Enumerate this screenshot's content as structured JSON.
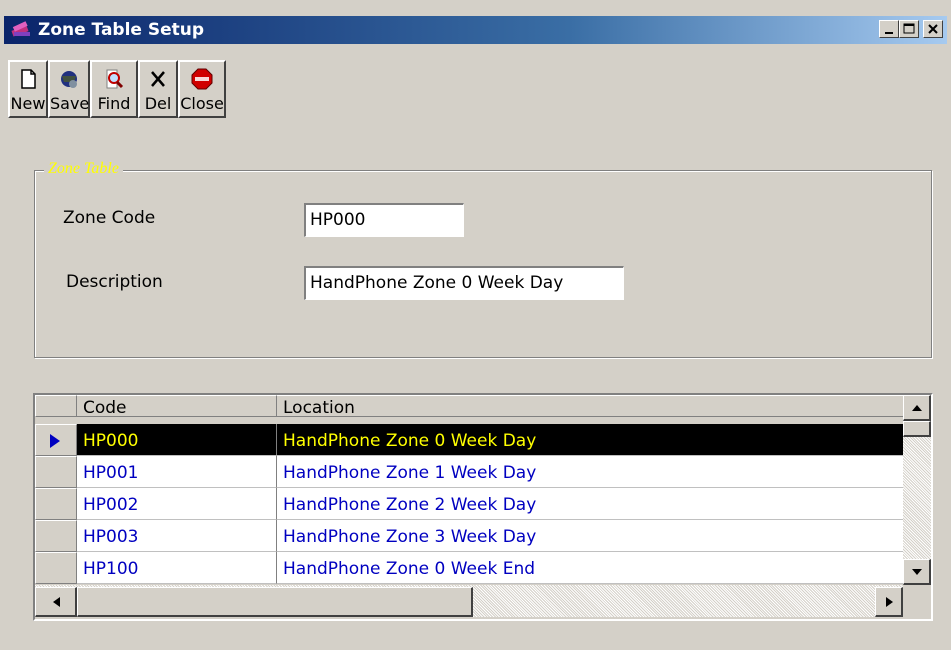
{
  "window": {
    "title": "Zone Table Setup",
    "controls": [
      "minimize",
      "maximize",
      "close"
    ]
  },
  "toolbar": {
    "buttons": [
      {
        "label": "New",
        "icon": "new-document-icon"
      },
      {
        "label": "Save",
        "icon": "save-icon"
      },
      {
        "label": "Find",
        "icon": "find-magnifier-icon"
      },
      {
        "label": "Del",
        "icon": "delete-x-icon"
      },
      {
        "label": "Close",
        "icon": "stop-sign-icon"
      }
    ]
  },
  "form": {
    "group_title": "Zone Table",
    "zone_code_label": "Zone Code",
    "zone_code_value": "HP000",
    "description_label": "Description",
    "description_value": "HandPhone Zone 0 Week Day"
  },
  "grid": {
    "columns": [
      "Code",
      "Location"
    ],
    "rows": [
      {
        "code": "HP000",
        "location": "HandPhone Zone 0 Week Day",
        "selected": true
      },
      {
        "code": "HP001",
        "location": "HandPhone Zone 1 Week Day",
        "selected": false
      },
      {
        "code": "HP002",
        "location": "HandPhone Zone 2 Week Day",
        "selected": false
      },
      {
        "code": "HP003",
        "location": "HandPhone Zone 3 Week Day",
        "selected": false
      },
      {
        "code": "HP100",
        "location": "HandPhone Zone 0 Week End",
        "selected": false
      }
    ]
  },
  "colors": {
    "title_bar": "#0a246a",
    "selected_row_bg": "#000000",
    "selected_row_text": "#ffff00",
    "row_text": "#0000c0",
    "group_title": "#ffff00"
  }
}
